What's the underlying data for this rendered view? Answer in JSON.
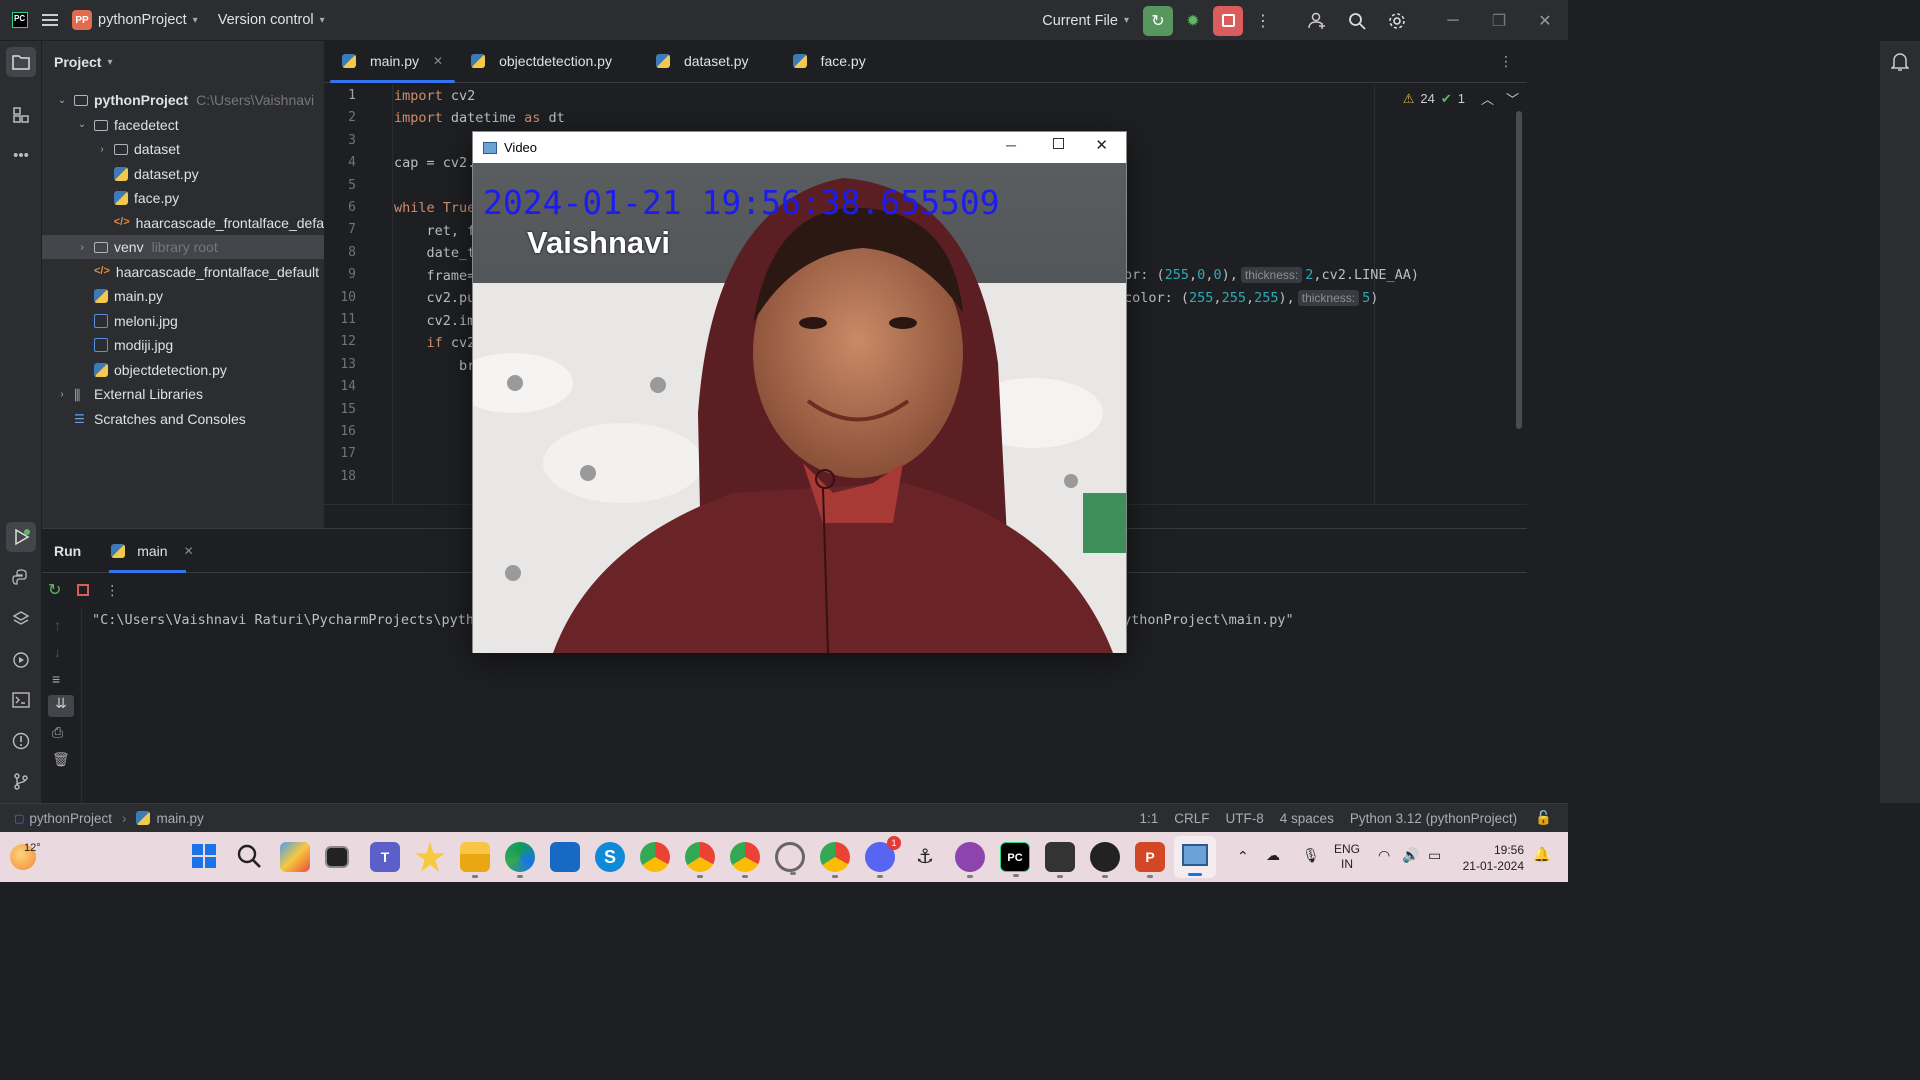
{
  "titlebar": {
    "project_badge": "PP",
    "project_name": "pythonProject",
    "vcs": "Version control",
    "run_config": "Current File"
  },
  "project_panel": {
    "title": "Project",
    "tree": [
      {
        "label": "pythonProject",
        "extra": "C:\\Users\\Vaishnavi",
        "type": "folder",
        "depth": 0,
        "expanded": true
      },
      {
        "label": "facedetect",
        "type": "folder",
        "depth": 1,
        "expanded": true
      },
      {
        "label": "dataset",
        "type": "folder",
        "depth": 2,
        "expanded": false
      },
      {
        "label": "dataset.py",
        "type": "py",
        "depth": 2
      },
      {
        "label": "face.py",
        "type": "py",
        "depth": 2
      },
      {
        "label": "haarcascade_frontalface_defa",
        "type": "xml",
        "depth": 2
      },
      {
        "label": "venv",
        "extra": "library root",
        "type": "folder",
        "depth": 1,
        "expanded": false,
        "selected": true
      },
      {
        "label": "haarcascade_frontalface_default",
        "type": "xml",
        "depth": 1
      },
      {
        "label": "main.py",
        "type": "py",
        "depth": 1
      },
      {
        "label": "meloni.jpg",
        "type": "img",
        "depth": 1
      },
      {
        "label": "modiji.jpg",
        "type": "img",
        "depth": 1
      },
      {
        "label": "objectdetection.py",
        "type": "py",
        "depth": 1
      },
      {
        "label": "External Libraries",
        "type": "lib",
        "depth": 0,
        "expanded": false
      },
      {
        "label": "Scratches and Consoles",
        "type": "scratch",
        "depth": 0
      }
    ]
  },
  "editor": {
    "tabs": [
      {
        "label": "main.py",
        "active": true
      },
      {
        "label": "objectdetection.py"
      },
      {
        "label": "dataset.py"
      },
      {
        "label": "face.py"
      }
    ],
    "warnings": "24",
    "checks": "1",
    "line_numbers": [
      "1",
      "2",
      "3",
      "4",
      "5",
      "6",
      "7",
      "8",
      "9",
      "10",
      "11",
      "12",
      "13",
      "14",
      "15",
      "16",
      "17",
      "18"
    ],
    "code": {
      "l1_kw": "import",
      "l1_rest": " cv2",
      "l2_kw": "import",
      "l2_mid": " datetime ",
      "l2_kw2": "as",
      "l2_rest": " dt",
      "l4": "cap = cv2.",
      "l6_kw": "while",
      "l6_rest": " True",
      "l7": "    ret, f",
      "l8": "    date_t",
      "l9": "    frame=",
      "l10": "    cv2.pu",
      "l11": "    cv2.im",
      "l12_kw": "    if",
      "l12_rest": " cv2",
      "l13": "        br",
      "l9_tail_a": "or: (",
      "l9_n1": "255",
      "l9_n2": "0",
      "l9_n3": "0",
      "l9_hint": "thickness:",
      "l9_n4": "2",
      "l9_tail_b": ",cv2.LINE_AA)",
      "l10_tail_a": "color: (",
      "l10_n1": "255",
      "l10_n2": "255",
      "l10_n3": "255",
      "l10_hint": "thickness:",
      "l10_n4": "5",
      "l10_tail_b": ")"
    }
  },
  "run_panel": {
    "title": "Run",
    "tab": "main",
    "output_left": "\"C:\\Users\\Vaishnavi Raturi\\PycharmProjects\\pyth",
    "output_right": "ythonProject\\main.py\""
  },
  "video_window": {
    "title": "Video",
    "timestamp": "2024-01-21 19:56:38.655509",
    "name_label": "Vaishnavi"
  },
  "statusbar": {
    "crumb_project": "pythonProject",
    "crumb_file": "main.py",
    "position": "1:1",
    "line_sep": "CRLF",
    "encoding": "UTF-8",
    "indent": "4 spaces",
    "interpreter": "Python 3.12 (pythonProject)"
  },
  "taskbar": {
    "weather": "12°",
    "lang1": "ENG",
    "lang2": "IN",
    "time": "19:56",
    "date": "21-01-2024",
    "discord_badge": "1"
  },
  "colors": {
    "accent": "#3574f0",
    "run_green": "#57965c",
    "stop_red": "#db5c5c",
    "timestamp_blue": "#1c1cf0"
  }
}
